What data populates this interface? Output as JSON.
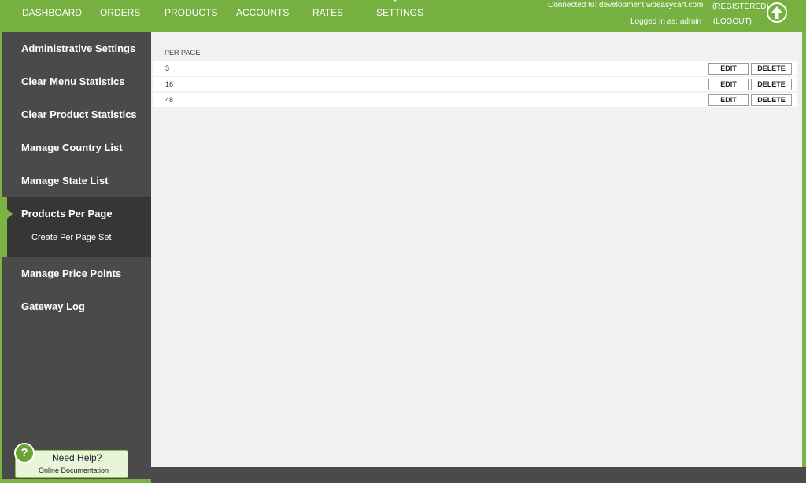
{
  "nav": {
    "items": [
      "DASHBOARD",
      "ORDERS",
      "PRODUCTS",
      "ACCOUNTS",
      "RATES",
      "SETTINGS"
    ],
    "active": "SETTINGS"
  },
  "header": {
    "connected": "Connected to: development.wpeasycart.com",
    "registered": "(REGISTERED)",
    "logged_in": "Logged in as: admin",
    "logout": "(LOGOUT)"
  },
  "sidebar": {
    "items": [
      "Administrative Settings",
      "Clear Menu Statistics",
      "Clear Product Statistics",
      "Manage Country List",
      "Manage State List",
      "Products Per Page",
      "Manage Price Points",
      "Gateway Log"
    ],
    "active": "Products Per Page",
    "subitem": "Create Per Page Set"
  },
  "table": {
    "header": "PER PAGE",
    "rows": [
      "3",
      "16",
      "48"
    ],
    "edit_label": "EDIT",
    "delete_label": "DELETE"
  },
  "help": {
    "icon": "?",
    "title": "Need Help?",
    "subtitle": "Online Documentation"
  },
  "colors": {
    "accent": "#7cb342",
    "sidebar": "#4a4a4a",
    "sidebar_active": "#363636",
    "content": "#f1f1f1"
  },
  "icons": {
    "up": "arrow-up-icon",
    "help": "help-icon",
    "active": "caret-right-icon"
  }
}
